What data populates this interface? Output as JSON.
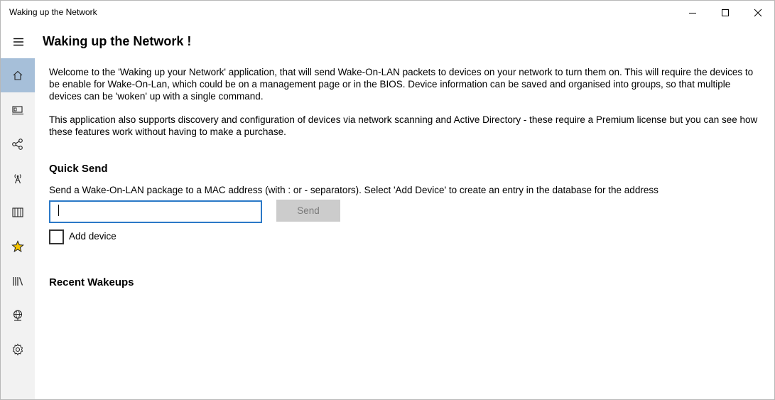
{
  "window": {
    "title": "Waking up the Network"
  },
  "header": {
    "page_title": "Waking up the Network !"
  },
  "nav": {
    "items": [
      {
        "icon": "home-icon",
        "selected": true
      },
      {
        "icon": "device-icon",
        "selected": false
      },
      {
        "icon": "network-groups-icon",
        "selected": false
      },
      {
        "icon": "wireless-scan-icon",
        "selected": false
      },
      {
        "icon": "book-icon",
        "selected": false
      },
      {
        "icon": "star-icon",
        "selected": false
      },
      {
        "icon": "library-icon",
        "selected": false
      },
      {
        "icon": "globe-network-icon",
        "selected": false
      },
      {
        "icon": "settings-icon",
        "selected": false
      }
    ]
  },
  "main": {
    "intro_1": "Welcome to the 'Waking up your Network' application, that will send Wake-On-LAN packets to devices on your network to turn them on. This will require the devices to be enable for Wake-On-Lan, which could be on a management page or in the BIOS. Device information can be saved and organised into groups, so that multiple devices can be 'woken' up with a single command.",
    "intro_2": "This application also supports discovery and configuration of devices via network scanning and Active Directory - these require a Premium license but you can see how these features work without having to make a purchase.",
    "quick_send": {
      "title": "Quick Send",
      "description": "Send a Wake-On-LAN package to a MAC address (with : or - separators). Select 'Add Device' to create an entry in the database for the address",
      "input_value": "",
      "send_label": "Send",
      "add_device_label": "Add device",
      "add_device_checked": false
    },
    "recent_title": "Recent Wakeups"
  },
  "colors": {
    "nav_background": "#f2f2f2",
    "nav_selected": "#a6bfd9",
    "input_border": "#2b79c7",
    "star": "#f5c400"
  }
}
